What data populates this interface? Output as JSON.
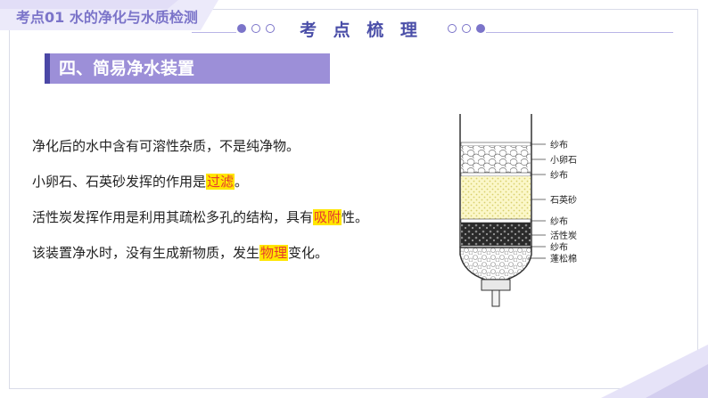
{
  "header": {
    "lesson_title": "考点01  水的净化与水质检测",
    "section_label": "考 点 梳 理"
  },
  "subtitle": "四、简易净水装置",
  "points": [
    {
      "before": "净化后的水中含有可溶性杂质，不是纯净物。",
      "highlight": "",
      "after": ""
    },
    {
      "before": "小卵石、石英砂发挥的作用是",
      "highlight": "过滤",
      "after": "。"
    },
    {
      "before": "活性炭发挥作用是利用其疏松多孔的结构，具有",
      "highlight": "吸附",
      "after": "性。"
    },
    {
      "before": "该装置净水时，没有生成新物质，发生",
      "highlight": "物理",
      "after": "变化。"
    }
  ],
  "diagram": {
    "labels": [
      "纱布",
      "小卵石",
      "纱布",
      "石英砂",
      "纱布",
      "活性炭",
      "纱布",
      "蓬松棉"
    ]
  },
  "colors": {
    "accent": "#7b74c9",
    "bar": "#9c8fd8",
    "highlight_bg": "#ffe600",
    "highlight_text": "#e63a2e"
  }
}
